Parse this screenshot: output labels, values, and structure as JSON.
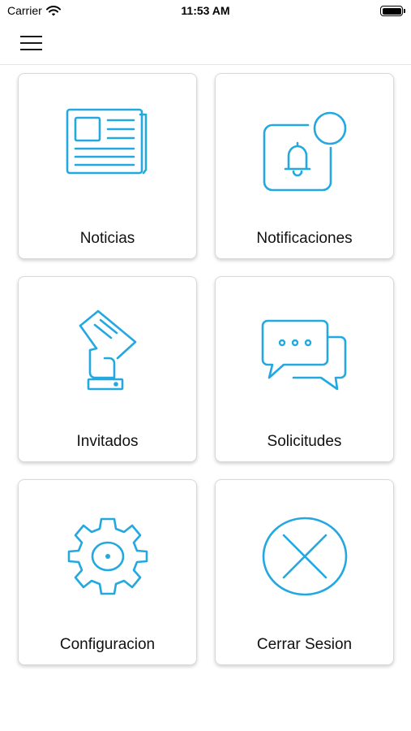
{
  "status_bar": {
    "carrier": "Carrier",
    "time": "11:53 AM"
  },
  "nav": {
    "menu_icon": "hamburger-menu-icon"
  },
  "colors": {
    "accent": "#23a8e0",
    "tile_border": "#d9d9d9"
  },
  "menu_tiles": [
    {
      "label": "Noticias",
      "icon": "newspaper-icon"
    },
    {
      "label": "Notificaciones",
      "icon": "notification-bell-icon"
    },
    {
      "label": "Invitados",
      "icon": "hand-card-icon"
    },
    {
      "label": "Solicitudes",
      "icon": "chat-bubbles-icon"
    },
    {
      "label": "Configuracion",
      "icon": "gear-icon"
    },
    {
      "label": "Cerrar Sesion",
      "icon": "close-circle-icon"
    }
  ]
}
